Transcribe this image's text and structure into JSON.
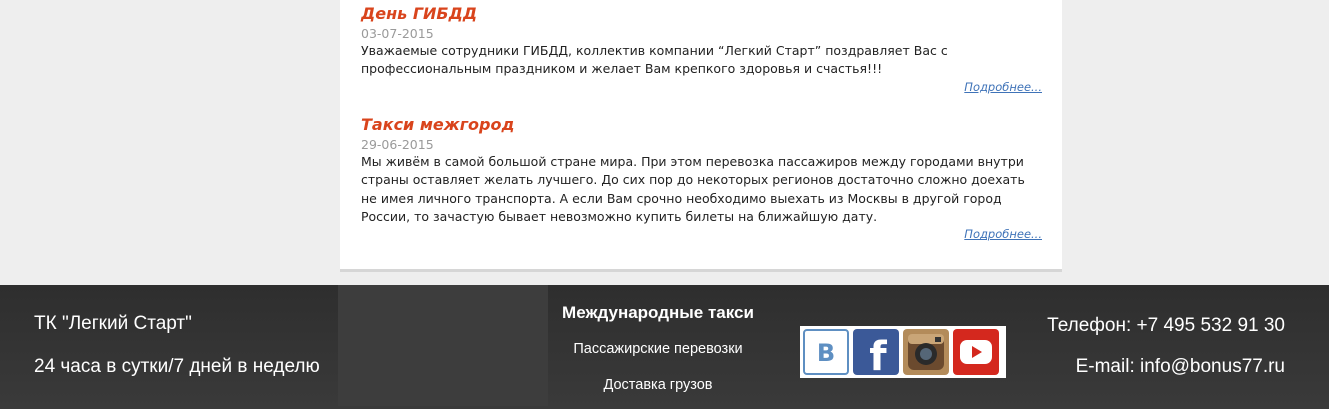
{
  "news": [
    {
      "title": "День ГИБДД",
      "date": "03-07-2015",
      "text": "Уважаемые сотрудники ГИБДД, коллектив компании “Легкий Старт” поздравляет Вас с профессиональным праздником и желает Вам крепкого здоровья и счастья!!!",
      "more": "Подробнее..."
    },
    {
      "title": "Такси межгород",
      "date": "29-06-2015",
      "text": "Мы живём в самой большой стране мира. При этом перевозка пассажиров между городами внутри страны оставляет желать лучшего. До сих пор до некоторых регионов достаточно сложно доехать не имея личного транспорта. А если Вам срочно необходимо выехать из Москвы в другой город России, то зачастую бывает невозможно купить билеты на ближайшую дату.",
      "more": "Подробнее..."
    }
  ],
  "footer": {
    "company": "ТК \"Легкий Старт\"",
    "hours": "24 часа в сутки/7 дней в неделю",
    "links_heading": "Международные такси",
    "links": [
      "Пассажирские перевозки",
      "Доставка грузов"
    ],
    "social": [
      {
        "icon": "vk-icon",
        "color": "#5e8fc2"
      },
      {
        "icon": "facebook-icon",
        "color": "#3b5998"
      },
      {
        "icon": "instagram-icon",
        "color": "#b38b5a"
      },
      {
        "icon": "youtube-icon",
        "color": "#d4281e"
      }
    ],
    "phone": "Телефон: +7 495 532 91 30",
    "email": "E-mail: info@bonus77.ru"
  },
  "colors": {
    "title_accent": "#d9441c",
    "link": "#3f73b8",
    "footer_bg": "#333333"
  }
}
